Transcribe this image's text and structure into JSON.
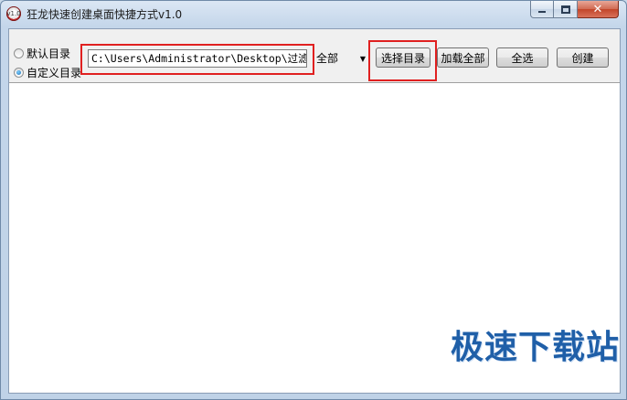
{
  "window": {
    "title": "狂龙快速创建桌面快捷方式v1.0",
    "icon": "app-logo-icon",
    "icon_text": "v1.0"
  },
  "caption": {
    "minimize_icon": "minimize-icon",
    "maximize_icon": "maximize-icon",
    "close_icon": "close-icon",
    "close_glyph": "✕"
  },
  "options": {
    "default_dir_label": "默认目录",
    "custom_dir_label": "自定义目录",
    "selected": "custom"
  },
  "path_field": {
    "value": "C:\\Users\\Administrator\\Desktop\\过滤"
  },
  "filter_select": {
    "value": "全部"
  },
  "buttons": {
    "choose_dir": "选择目录",
    "load_all": "加载全部",
    "select_all": "全选",
    "create": "创建"
  },
  "watermark": {
    "text": "极速下载站"
  },
  "colors": {
    "highlight": "#e02020",
    "watermark": "#1f5fa8"
  }
}
